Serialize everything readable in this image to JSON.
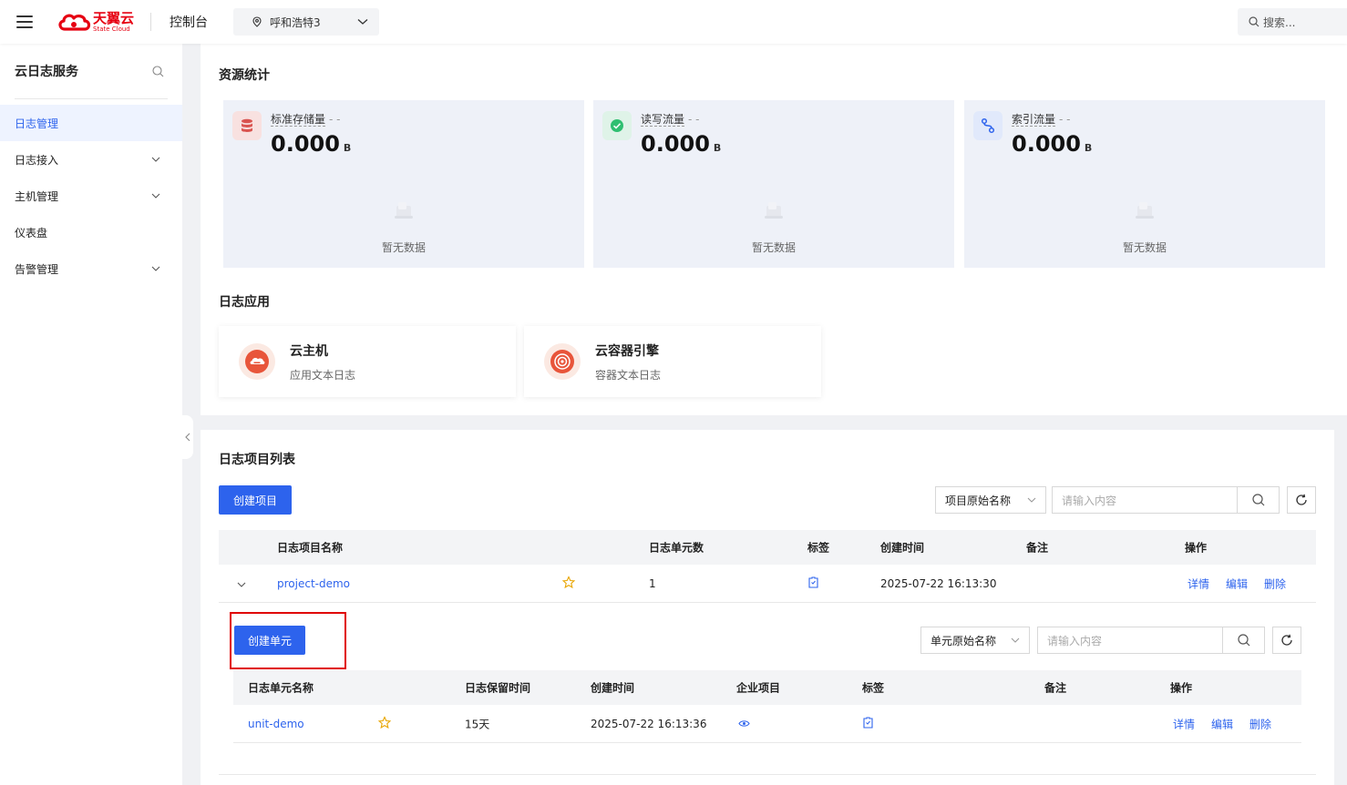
{
  "header": {
    "logo_cn": "天翼云",
    "logo_en": "State Cloud",
    "console": "控制台",
    "region": "呼和浩特3",
    "search_placeholder": "搜索..."
  },
  "sidebar": {
    "title": "云日志服务",
    "items": [
      {
        "label": "日志管理",
        "active": true,
        "has_children": false
      },
      {
        "label": "日志接入",
        "active": false,
        "has_children": true
      },
      {
        "label": "主机管理",
        "active": false,
        "has_children": true
      },
      {
        "label": "仪表盘",
        "active": false,
        "has_children": false
      },
      {
        "label": "告警管理",
        "active": false,
        "has_children": true
      }
    ]
  },
  "resource_stats": {
    "title": "资源统计",
    "cards": [
      {
        "label": "标准存储量",
        "dash": "- -",
        "value": "0.000",
        "unit": "B",
        "empty": "暂无数据",
        "icon": "database-icon",
        "color": "#d9534f"
      },
      {
        "label": "读写流量",
        "dash": "- -",
        "value": "0.000",
        "unit": "B",
        "empty": "暂无数据",
        "icon": "check-circle-icon",
        "color": "#2fbf71"
      },
      {
        "label": "索引流量",
        "dash": "- -",
        "value": "0.000",
        "unit": "B",
        "empty": "暂无数据",
        "icon": "flow-icon",
        "color": "#2d63ed"
      }
    ]
  },
  "log_apps": {
    "title": "日志应用",
    "items": [
      {
        "name": "云主机",
        "desc": "应用文本日志",
        "icon": "cloud-host-icon"
      },
      {
        "name": "云容器引擎",
        "desc": "容器文本日志",
        "icon": "container-engine-icon"
      }
    ]
  },
  "project_list": {
    "title": "日志项目列表",
    "create_btn": "创建项目",
    "filter_select": "项目原始名称",
    "filter_placeholder": "请输入内容",
    "columns": [
      "日志项目名称",
      "日志单元数",
      "标签",
      "创建时间",
      "备注",
      "操作"
    ],
    "rows": [
      {
        "name": "project-demo",
        "units": "1",
        "created": "2025-07-22 16:13:30",
        "note": "",
        "actions": [
          "详情",
          "编辑",
          "删除"
        ]
      }
    ]
  },
  "unit_list": {
    "create_btn": "创建单元",
    "filter_select": "单元原始名称",
    "filter_placeholder": "请输入内容",
    "columns": [
      "日志单元名称",
      "日志保留时间",
      "创建时间",
      "企业项目",
      "标签",
      "备注",
      "操作"
    ],
    "rows": [
      {
        "name": "unit-demo",
        "retention": "15天",
        "created": "2025-07-22 16:13:36",
        "note": "",
        "actions": [
          "详情",
          "编辑",
          "删除"
        ]
      }
    ]
  },
  "colors": {
    "primary": "#2d63ed",
    "highlight_box": "#e00000",
    "brand_red": "#e60012"
  }
}
